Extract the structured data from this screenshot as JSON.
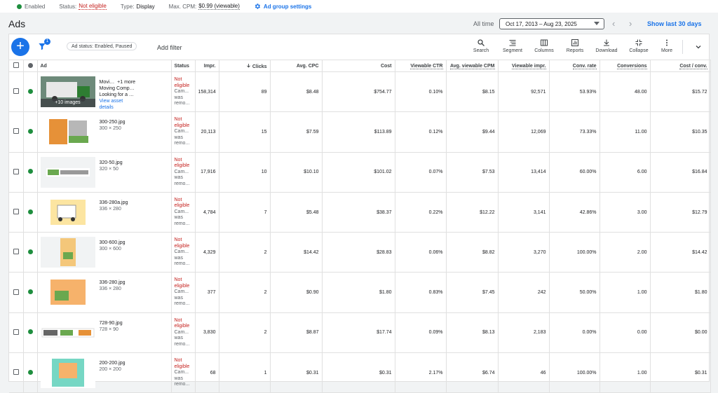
{
  "topbar": {
    "enabled": "Enabled",
    "status_label": "Status:",
    "status_value": "Not eligible",
    "type_label": "Type:",
    "type_value": "Display",
    "cpm_label": "Max. CPM:",
    "cpm_value": "$0.99 (viewable)",
    "settings_link": "Ad group settings"
  },
  "header": {
    "title": "Ads",
    "all_time": "All time",
    "date_range": "Oct 17, 2013 – Aug 23, 2025",
    "show_last": "Show last 30 days"
  },
  "toolbar": {
    "filter_count": "1",
    "chip": "Ad status: Enabled, Paused",
    "add_filter": "Add filter",
    "tools": [
      "Search",
      "Segment",
      "Columns",
      "Reports",
      "Download",
      "Collapse",
      "More"
    ]
  },
  "columns": {
    "ad": "Ad",
    "status": "Status",
    "impr": "Impr.",
    "clicks": "Clicks",
    "avg_cpc": "Avg. CPC",
    "cost": "Cost",
    "viewable_ctr": "Viewable CTR",
    "avg_viewable_cpm": "Avg. viewable CPM",
    "viewable_impr": "Viewable impr.",
    "conv_rate": "Conv. rate",
    "conversions": "Conversions",
    "cost_conv": "Cost / conv."
  },
  "status_text": {
    "not_eligible": "Not eligible",
    "sub1": "Cam...",
    "sub2": "was",
    "sub3": "remo..."
  },
  "rows": [
    {
      "name": "Movi…",
      "more": "+1 more",
      "line2": "Moving Comp…",
      "line3": "Looking for a …",
      "link1": "View asset",
      "link2": "details",
      "overlay": "+10 images",
      "impr": "158,314",
      "clicks": "89",
      "cpc": "$8.48",
      "cost": "$754.77",
      "vctr": "0.10%",
      "vcpm": "$8.15",
      "vimpr": "92,571",
      "crate": "53.93%",
      "conv": "48.00",
      "cpconv": "$15.72"
    },
    {
      "name": "300-250.jpg",
      "size": "300 × 250",
      "impr": "20,113",
      "clicks": "15",
      "cpc": "$7.59",
      "cost": "$113.89",
      "vctr": "0.12%",
      "vcpm": "$9.44",
      "vimpr": "12,069",
      "crate": "73.33%",
      "conv": "11.00",
      "cpconv": "$10.35"
    },
    {
      "name": "320-50.jpg",
      "size": "320 × 50",
      "impr": "17,916",
      "clicks": "10",
      "cpc": "$10.10",
      "cost": "$101.02",
      "vctr": "0.07%",
      "vcpm": "$7.53",
      "vimpr": "13,414",
      "crate": "60.00%",
      "conv": "6.00",
      "cpconv": "$16.84"
    },
    {
      "name": "336-280a.jpg",
      "size": "336 × 280",
      "impr": "4,784",
      "clicks": "7",
      "cpc": "$5.48",
      "cost": "$38.37",
      "vctr": "0.22%",
      "vcpm": "$12.22",
      "vimpr": "3,141",
      "crate": "42.86%",
      "conv": "3.00",
      "cpconv": "$12.79"
    },
    {
      "name": "300-600.jpg",
      "size": "300 × 600",
      "impr": "4,329",
      "clicks": "2",
      "cpc": "$14.42",
      "cost": "$28.83",
      "vctr": "0.06%",
      "vcpm": "$8.82",
      "vimpr": "3,270",
      "crate": "100.00%",
      "conv": "2.00",
      "cpconv": "$14.42"
    },
    {
      "name": "336-280.jpg",
      "size": "336 × 280",
      "impr": "377",
      "clicks": "2",
      "cpc": "$0.90",
      "cost": "$1.80",
      "vctr": "0.83%",
      "vcpm": "$7.45",
      "vimpr": "242",
      "crate": "50.00%",
      "conv": "1.00",
      "cpconv": "$1.80"
    },
    {
      "name": "728-90.jpg",
      "size": "728 × 90",
      "impr": "3,830",
      "clicks": "2",
      "cpc": "$8.87",
      "cost": "$17.74",
      "vctr": "0.09%",
      "vcpm": "$8.13",
      "vimpr": "2,183",
      "crate": "0.00%",
      "conv": "0.00",
      "cpconv": "$0.00"
    },
    {
      "name": "200-200.jpg",
      "size": "200 × 200",
      "impr": "68",
      "clicks": "1",
      "cpc": "$0.31",
      "cost": "$0.31",
      "vctr": "2.17%",
      "vcpm": "$6.74",
      "vimpr": "46",
      "crate": "100.00%",
      "conv": "1.00",
      "cpconv": "$0.31"
    }
  ],
  "colors": {
    "accent": "#1a73e8",
    "enabled": "#1e8e3e",
    "error": "#c5221f"
  }
}
